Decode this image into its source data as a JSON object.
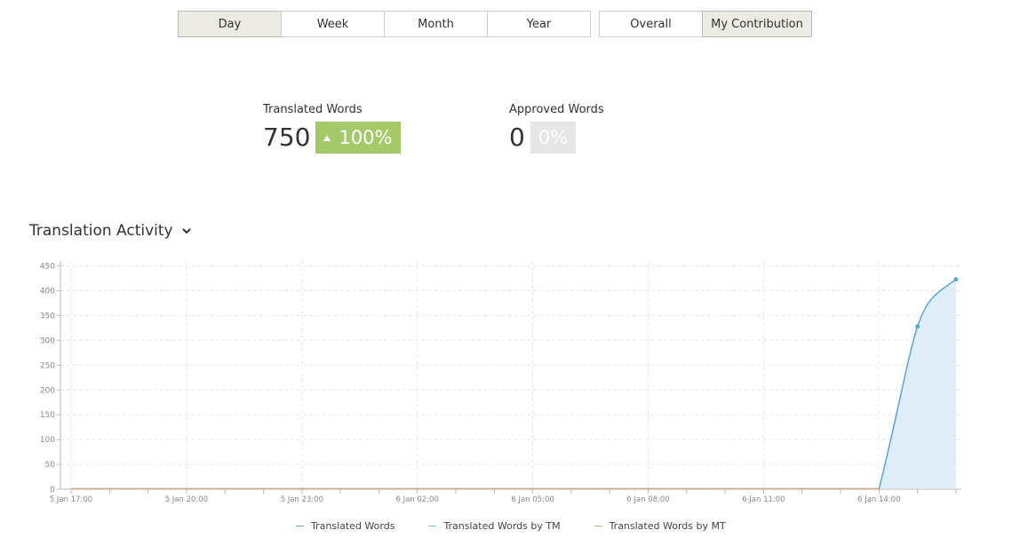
{
  "period_tabs": [
    {
      "label": "Day",
      "active": true
    },
    {
      "label": "Week",
      "active": false
    },
    {
      "label": "Month",
      "active": false
    },
    {
      "label": "Year",
      "active": false
    }
  ],
  "scope_tabs": [
    {
      "label": "Overall",
      "active": false
    },
    {
      "label": "My Contribution",
      "active": true
    }
  ],
  "stats": {
    "translated": {
      "label": "Translated Words",
      "value": "750",
      "change": "100%",
      "trend": "up"
    },
    "approved": {
      "label": "Approved Words",
      "value": "0",
      "change": "0%",
      "trend": "none"
    }
  },
  "section": {
    "title": "Translation Activity",
    "toggle_icon": "chevron-down-icon"
  },
  "colors": {
    "active_tab": "#ebeae3",
    "badge_up": "#a3c969",
    "badge_neutral": "#e6e6e6",
    "series_translated": "#5aa5d4",
    "series_tm": "#7ec8c4",
    "series_mt": "#e0a070",
    "area_fill": "#dcebf8"
  },
  "chart_data": {
    "type": "area",
    "y_ticks": [
      0,
      50,
      100,
      150,
      200,
      250,
      300,
      350,
      400,
      450
    ],
    "ylim": [
      0,
      460
    ],
    "x_tick_labels": [
      "5 Jan 17:00",
      "5 Jan 20:00",
      "5 Jan 23:00",
      "6 Jan 02:00",
      "6 Jan 05:00",
      "6 Jan 08:00",
      "6 Jan 11:00",
      "6 Jan 14:00"
    ],
    "grid": true,
    "legend_position": "bottom",
    "series": [
      {
        "name": "Translated Words",
        "x": [
          "6 Jan 14:00",
          "6 Jan 15:00",
          "6 Jan 16:00"
        ],
        "values": [
          0,
          328,
          423
        ]
      },
      {
        "name": "Translated Words by TM",
        "values": []
      },
      {
        "name": "Translated Words by MT",
        "values": []
      }
    ]
  }
}
